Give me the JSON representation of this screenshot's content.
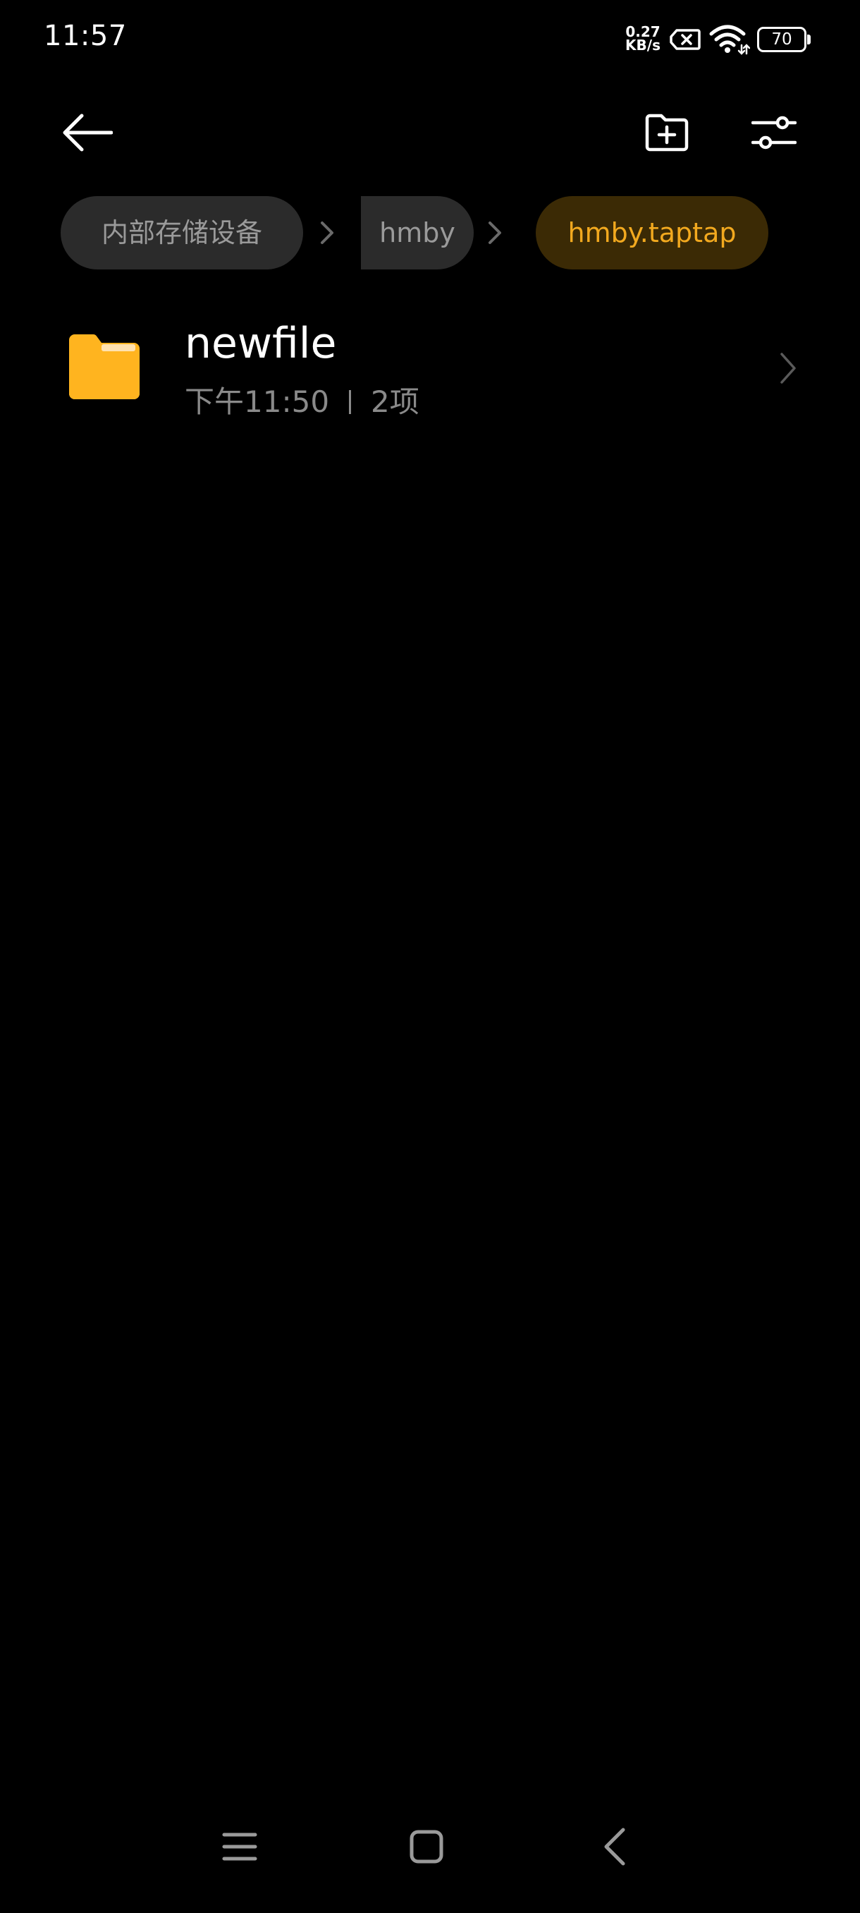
{
  "status_bar": {
    "time": "11:57",
    "net_speed_value": "0.27",
    "net_speed_unit": "KB/s",
    "battery_level": "70",
    "icons": [
      "no-sim-icon",
      "wifi-icon",
      "battery-icon"
    ]
  },
  "toolbar": {
    "icons": [
      "back-arrow-icon",
      "new-folder-icon",
      "sort-filter-icon"
    ]
  },
  "breadcrumb": {
    "items": [
      {
        "label": "内部存储设备",
        "current": false
      },
      {
        "label": "hmby",
        "current": false
      },
      {
        "label": "hmby.taptap",
        "current": true
      }
    ]
  },
  "files": [
    {
      "name": "newfile",
      "time": "下午11:50",
      "count": "2项",
      "icon": "folder-icon"
    }
  ],
  "nav_bar": {
    "icons": [
      "menu-icon",
      "home-icon",
      "back-icon"
    ]
  },
  "colors": {
    "background": "#000000",
    "accent": "#f2a91f",
    "accent_bg": "#3b2a05",
    "chip_bg": "#2b2b2b",
    "folder": "#ffb41f",
    "secondary_text": "#8a8a8a"
  }
}
